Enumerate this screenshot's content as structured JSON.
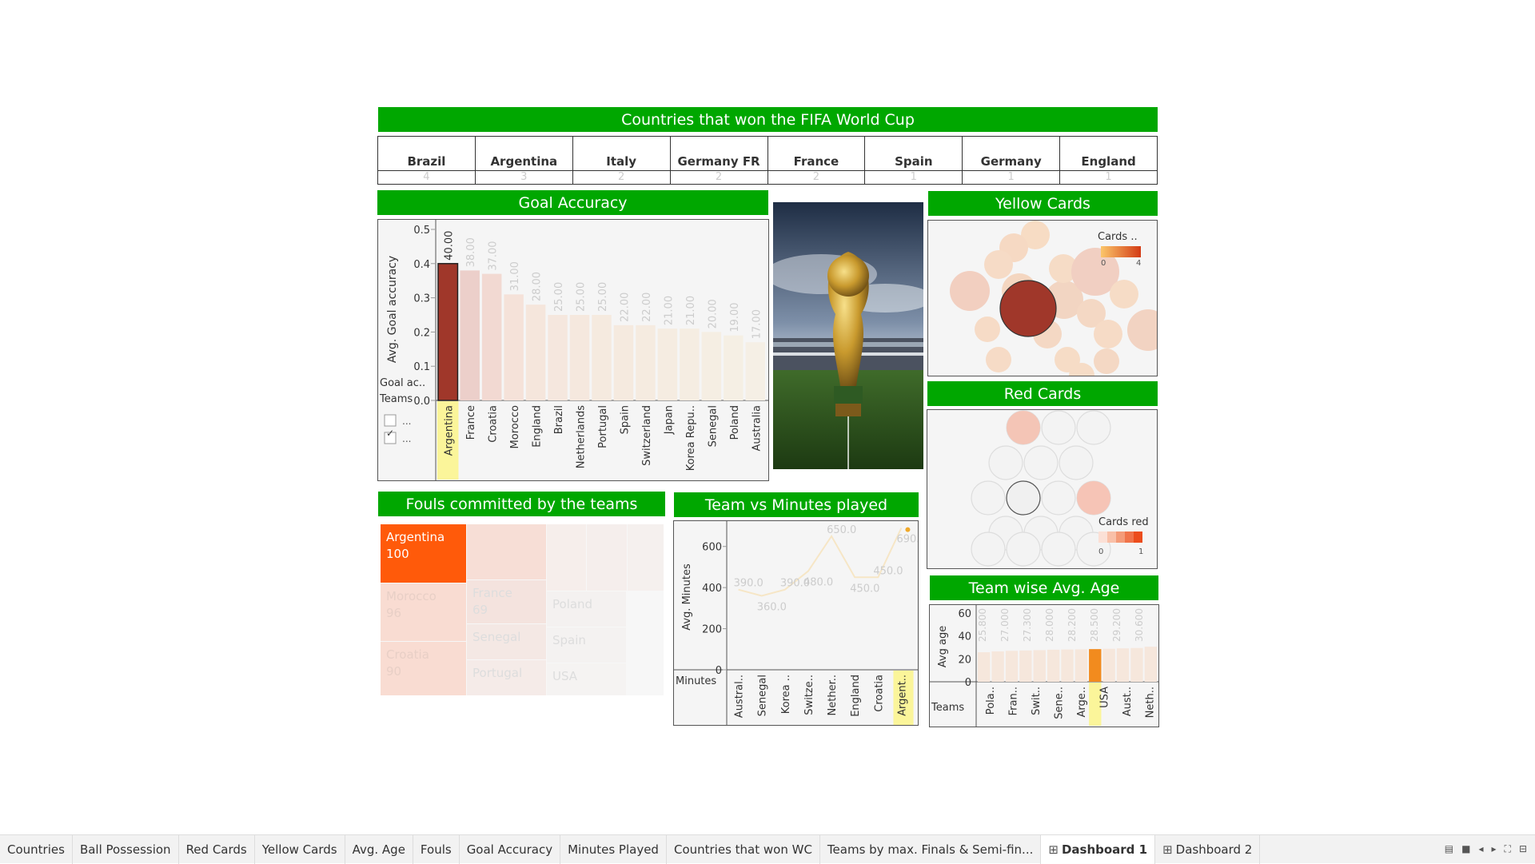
{
  "titles": {
    "champions": "Countries that won the FIFA World Cup",
    "goal_accuracy": "Goal Accuracy",
    "yellow_cards": "Yellow Cards",
    "red_cards": "Red Cards",
    "fouls": "Fouls committed by the teams",
    "minutes": "Team vs Minutes played",
    "age": "Team wise Avg. Age"
  },
  "champions": [
    {
      "name": "Brazil",
      "wins": "4"
    },
    {
      "name": "Argentina",
      "wins": "3"
    },
    {
      "name": "Italy",
      "wins": "2"
    },
    {
      "name": "Germany FR",
      "wins": "2"
    },
    {
      "name": "France",
      "wins": "2"
    },
    {
      "name": "Spain",
      "wins": "1"
    },
    {
      "name": "Germany",
      "wins": "1"
    },
    {
      "name": "England",
      "wins": "1"
    }
  ],
  "goal_panel": {
    "ylabel": "Avg. Goal accuracy",
    "corner_label": "Goal ac..",
    "teams_label": "Teams",
    "filter_items": [
      "...",
      "..."
    ]
  },
  "yellow_legend": {
    "title": "Cards ..",
    "min": "0",
    "max": "4"
  },
  "red_legend": {
    "title": "Cards red",
    "min": "0",
    "max": "1"
  },
  "fouls_cells": [
    {
      "team": "Argentina",
      "value": "100"
    },
    {
      "team": "Morocco",
      "value": "96"
    },
    {
      "team": "Croatia",
      "value": "90"
    },
    {
      "team": "France",
      "value": "69"
    },
    {
      "team": "Senegal",
      "value": ""
    },
    {
      "team": "Portugal",
      "value": ""
    },
    {
      "team": "Poland",
      "value": ""
    },
    {
      "team": "Spain",
      "value": ""
    },
    {
      "team": "USA",
      "value": ""
    }
  ],
  "minutes_panel": {
    "ylabel": "Avg. Minutes",
    "xlabel": "Minutes"
  },
  "age_panel": {
    "ylabel": "Avg age",
    "xlabel": "Teams"
  },
  "sheet_tabs": [
    "Countries",
    "Ball Possession",
    "Red Cards",
    "Yellow Cards",
    "Avg. Age",
    "Fouls",
    "Goal Accuracy",
    "Minutes Played",
    "Countries that won WC",
    "Teams by max. Finals & Semi-fin...",
    "Dashboard 1",
    "Dashboard 2"
  ],
  "active_tab": "Dashboard 1",
  "colors": {
    "header": "#00a700",
    "highlight": "#a0372a",
    "fouls_top": "#ff5a0a",
    "age_highlight": "#f28b1e"
  },
  "chart_data": [
    {
      "type": "bar",
      "title": "Goal Accuracy",
      "ylabel": "Avg. Goal accuracy",
      "xlabel": "Teams",
      "ylim": [
        0,
        0.5
      ],
      "yticks": [
        "0.0",
        "0.1",
        "0.2",
        "0.3",
        "0.4",
        "0.5"
      ],
      "categories": [
        "Argentina",
        "France",
        "Croatia",
        "Morocco",
        "England",
        "Brazil",
        "Netherlands",
        "Portugal",
        "Spain",
        "Switzerland",
        "Japan",
        "Korea Repu..",
        "Senegal",
        "Poland",
        "Australia"
      ],
      "values": [
        0.4,
        0.38,
        0.37,
        0.31,
        0.28,
        0.25,
        0.25,
        0.25,
        0.22,
        0.22,
        0.21,
        0.21,
        0.2,
        0.19,
        0.17
      ],
      "labels": [
        "40.00",
        "38.00",
        "37.00",
        "31.00",
        "28.00",
        "25.00",
        "25.00",
        "25.00",
        "22.00",
        "22.00",
        "21.00",
        "21.00",
        "20.00",
        "19.00",
        "17.00"
      ],
      "highlight": "Argentina"
    },
    {
      "type": "line",
      "title": "Team vs Minutes played",
      "ylabel": "Avg. Minutes",
      "xlabel": "Minutes",
      "ylim": [
        0,
        700
      ],
      "yticks": [
        "0",
        "200",
        "400",
        "600"
      ],
      "categories": [
        "Austral..",
        "Senegal",
        "Korea ..",
        "Switze..",
        "Nether..",
        "England",
        "Croatia",
        "Argent.."
      ],
      "points": [
        390,
        360,
        390,
        480,
        650,
        450,
        450,
        690
      ],
      "labels": [
        "390.0",
        "360.0",
        "390.0",
        "480.0",
        "650.0",
        "450.0",
        "450.0",
        "690.0"
      ],
      "highlight": "Argent.."
    },
    {
      "type": "bar",
      "title": "Team wise Avg. Age",
      "ylabel": "Avg age",
      "xlabel": "Teams",
      "ylim": [
        0,
        60
      ],
      "yticks": [
        "0",
        "20",
        "40",
        "60"
      ],
      "categories": [
        "Pola..",
        "Fran..",
        "Swit..",
        "Sene..",
        "Arge..",
        "USA",
        "Aust..",
        "Neth.."
      ],
      "values": [
        25.8,
        26.5,
        27.0,
        27.3,
        27.6,
        28.0,
        28.2,
        28.3,
        28.5,
        28.8,
        29.2,
        29.5,
        30.6
      ],
      "labels": [
        "25.800",
        "27.000",
        "27.300",
        "28.000",
        "28.200",
        "28.500",
        "29.200",
        "30.600"
      ],
      "highlight_index": 8
    }
  ]
}
